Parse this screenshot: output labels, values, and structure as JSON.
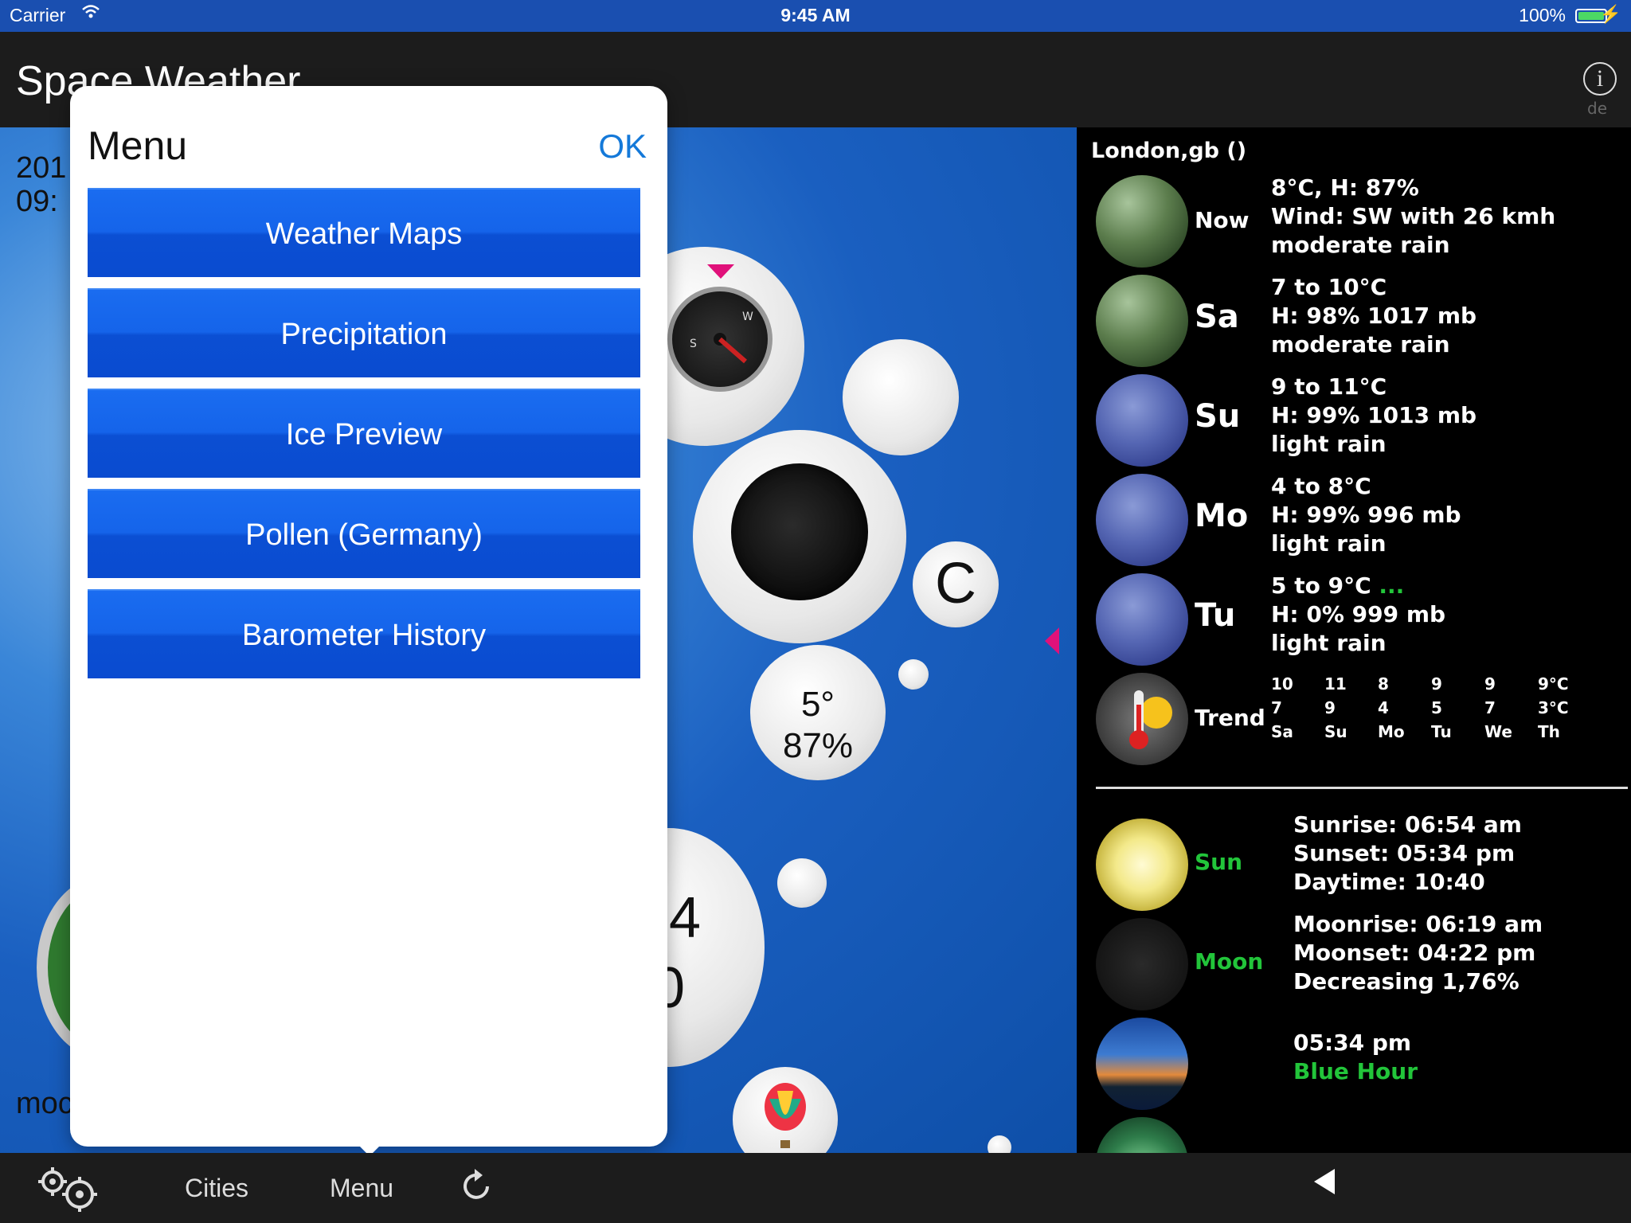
{
  "status_bar": {
    "carrier": "Carrier",
    "time": "9:45 AM",
    "battery_percent": "100%",
    "battery_level": 1.0
  },
  "nav": {
    "title": "Space Weather",
    "info_icon": "info-icon",
    "info_sub": "de"
  },
  "main": {
    "date_partial": "201",
    "time_partial": "09:",
    "bottom_partial": "moc",
    "temp_unit": "C",
    "reading_temp": "5°",
    "reading_humidity": "87%",
    "partial_value_1": ".4",
    "partial_value_2": "0"
  },
  "menu": {
    "title": "Menu",
    "ok": "OK",
    "items": [
      "Weather Maps",
      "Precipitation",
      "Ice Preview",
      "Pollen (Germany)",
      "Barometer History"
    ]
  },
  "forecast": {
    "city": "London,gb ()",
    "rows": [
      {
        "label": "Now",
        "line1": "8°C, H: 87%",
        "line2": "Wind: SW with 26 kmh",
        "line3": "moderate rain",
        "icon": "rain-icon"
      },
      {
        "label": "Sa",
        "line1": "7 to 10°C",
        "line2": "H: 98% 1017 mb",
        "line3": "moderate rain",
        "icon": "rain-icon"
      },
      {
        "label": "Su",
        "line1": "9 to 11°C",
        "line2": "H: 99% 1013 mb",
        "line3": "light rain",
        "icon": "light-rain-icon"
      },
      {
        "label": "Mo",
        "line1": "4 to 8°C",
        "line2": "H: 99% 996 mb",
        "line3": "light rain",
        "icon": "light-rain-icon"
      },
      {
        "label": "Tu",
        "line1": "5 to 9°C",
        "line1_extra": "...",
        "line2": "H: 0% 999 mb",
        "line3": "light rain",
        "icon": "light-rain-icon"
      }
    ],
    "trend": {
      "label": "Trend",
      "icon": "thermometer-sun-icon",
      "highs": [
        "10",
        "11",
        "8",
        "9",
        "9",
        "9°C"
      ],
      "lows": [
        "7",
        "9",
        "4",
        "5",
        "7",
        "3°C"
      ],
      "days": [
        "Sa",
        "Su",
        "Mo",
        "Tu",
        "We",
        "Th"
      ]
    }
  },
  "astro": {
    "sun": {
      "label": "Sun",
      "sunrise": "Sunrise: 06:54 am",
      "sunset": "Sunset: 05:34 pm",
      "daytime": "Daytime: 10:40"
    },
    "moon": {
      "label": "Moon",
      "moonrise": "Moonrise: 06:19 am",
      "moonset": "Moonset: 04:22 pm",
      "phase": "Decreasing 1,76%"
    },
    "blue_hour": {
      "time": "05:34 pm",
      "label": "Blue Hour"
    }
  },
  "tabbar": {
    "settings_icon": "settings-gears-icon",
    "cities": "Cities",
    "menu": "Menu",
    "refresh_icon": "refresh-icon",
    "back_icon": "back-triangle-icon"
  },
  "colors": {
    "menu_button_blue": "#1564ea",
    "ok_blue": "#1479d9",
    "accent_green": "#22c53a",
    "status_bar_blue": "#1a4fb0"
  }
}
